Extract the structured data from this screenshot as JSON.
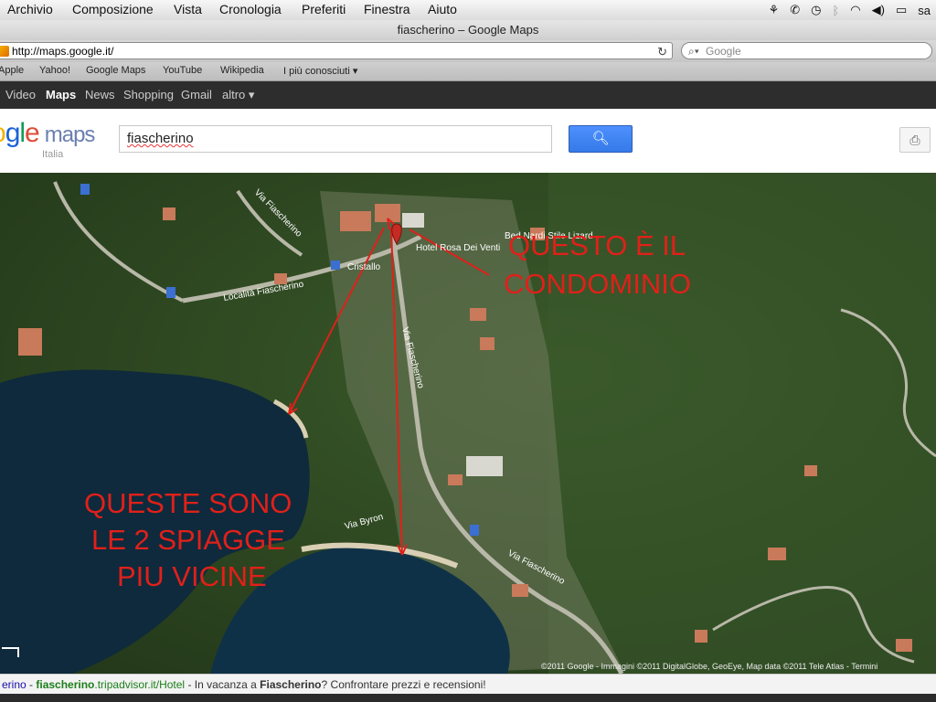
{
  "menubar": {
    "items": [
      "Archivio",
      "Composizione",
      "Vista",
      "Cronologia",
      "Preferiti",
      "Finestra",
      "Aiuto"
    ],
    "tray_text": "sa",
    "tray_icons": [
      "transmit-icon",
      "call-icon",
      "time-machine-icon",
      "bluetooth-icon",
      "wifi-icon",
      "volume-icon",
      "battery-icon"
    ]
  },
  "window": {
    "title": "fiascherino – Google Maps"
  },
  "toolbar": {
    "url": "http://maps.google.it/",
    "search_placeholder": "Google"
  },
  "bookmarks": [
    "Apple",
    "Yahoo!",
    "Google Maps",
    "YouTube",
    "Wikipedia",
    "I più conosciuti ▾"
  ],
  "gbar": {
    "items": [
      "Video",
      "Maps",
      "News",
      "Shopping",
      "Gmail",
      "altro ▾"
    ],
    "active": "Maps"
  },
  "header": {
    "logo_text": "gle maps",
    "logo_sub": "Italia",
    "search_value": "fiascherino"
  },
  "map": {
    "labels": {
      "via_fiascherino_top": "Via Fiascherino",
      "localita": "Località Fiascherino",
      "cristallo": "Cristallo",
      "hotel_rosa": "Hotel Rosa Dei Venti",
      "bed_breakfast": "Bed Nardi Stile Lizard",
      "via_fiascherino_mid": "Via Fiascherino",
      "via_byron": "Via Byron",
      "via_fiascherino_low": "Via Fiascherino"
    },
    "annotations": {
      "condominio": [
        "QUESTO È IL",
        "CONDOMINIO"
      ],
      "spiagge": [
        "QUESTE SONO",
        "LE 2 SPIAGGE",
        "PIU VICINE"
      ]
    },
    "copyright": "©2011 Google - Immagini ©2011 DigitalGlobe, GeoEye, Map data ©2011 Tele Atlas - Termini",
    "colors": {
      "annotation": "#e0201a",
      "sea": "#0e2a3c",
      "forest": "#2f4a22"
    }
  },
  "footer": {
    "pre": "erino",
    "sep1": " - ",
    "link_pre": "fiascherino",
    "link_post": ".tripadvisor.it/Hotel",
    "sep2": " - In vacanza a ",
    "bold": "Fiascherino",
    "post": "? Confrontare prezzi e recensioni!"
  }
}
